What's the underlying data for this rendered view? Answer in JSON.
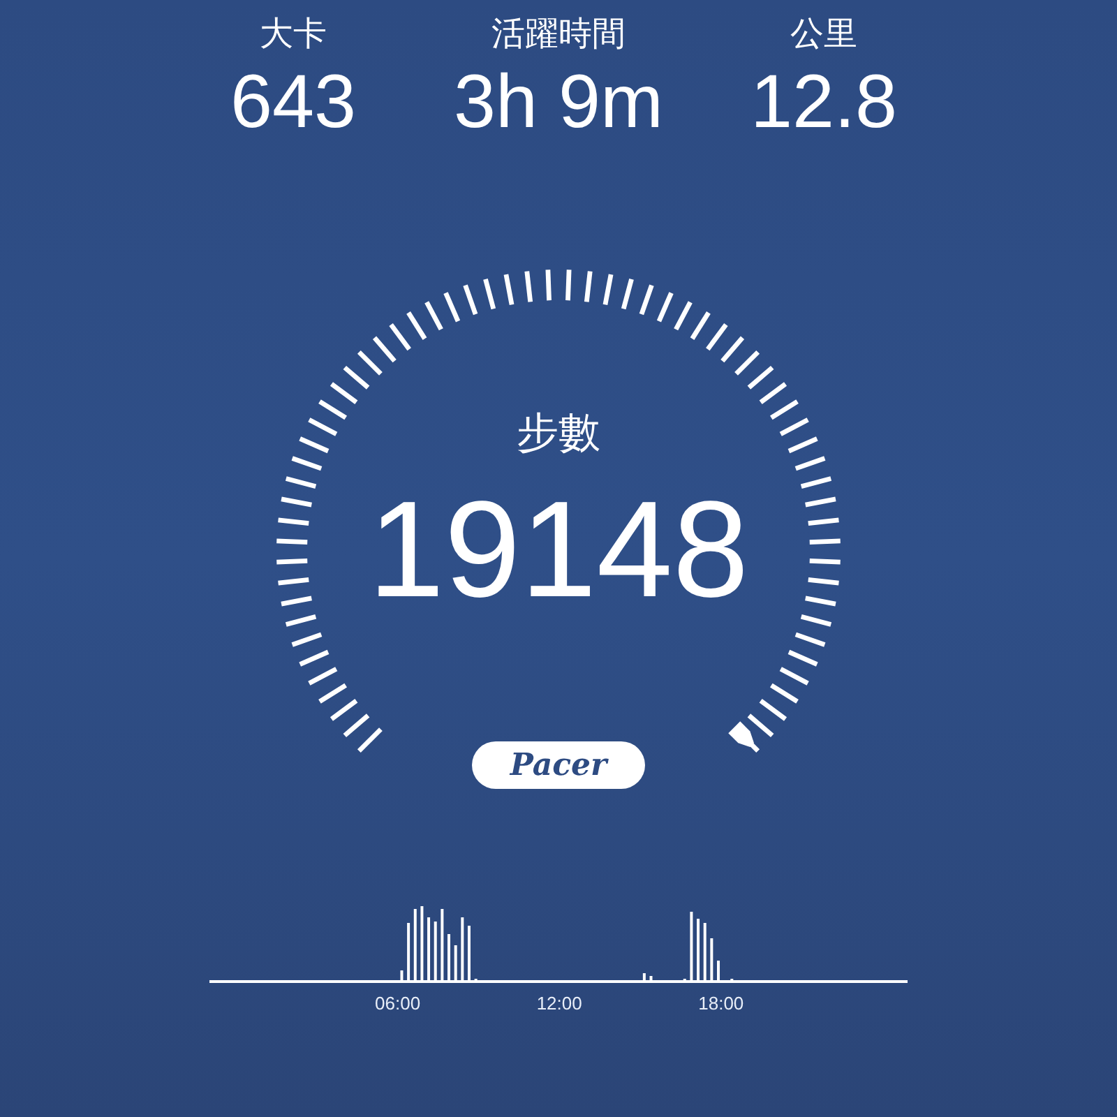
{
  "stats": [
    {
      "label": "大卡",
      "value": "643"
    },
    {
      "label": "活躍時間",
      "value": "3h 9m"
    },
    {
      "label": "公里",
      "value": "12.8"
    }
  ],
  "gauge": {
    "label": "步數",
    "value": "19148"
  },
  "logo": {
    "text": "Pacer"
  },
  "activity_chart": {
    "time_labels": [
      "06:00",
      "12:00",
      "18:00"
    ]
  }
}
